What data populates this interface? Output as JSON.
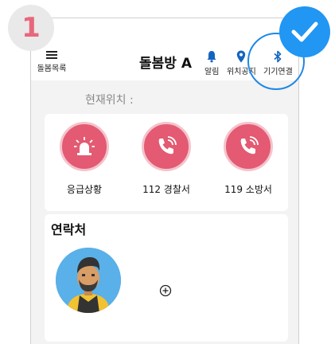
{
  "step": {
    "number": "1"
  },
  "header": {
    "menu_label": "돌봄목록",
    "title": "돌봄방 A",
    "actions": [
      {
        "label": "알림",
        "icon": "bell-icon"
      },
      {
        "label": "위치공지",
        "icon": "location-pin-icon"
      },
      {
        "label": "기기연결",
        "icon": "bluetooth-icon"
      }
    ]
  },
  "location": {
    "label": "현재위치 :"
  },
  "emergency": {
    "buttons": [
      {
        "label": "응급상황",
        "icon": "siren-icon"
      },
      {
        "label": "112 경찰서",
        "icon": "phone-ringing-icon"
      },
      {
        "label": "119 소방서",
        "icon": "phone-ringing-icon"
      }
    ]
  },
  "contacts": {
    "title": "연락처"
  },
  "colors": {
    "accent": "#e35a72",
    "highlight": "#1e88e5",
    "check_badge": "#2196f3"
  }
}
